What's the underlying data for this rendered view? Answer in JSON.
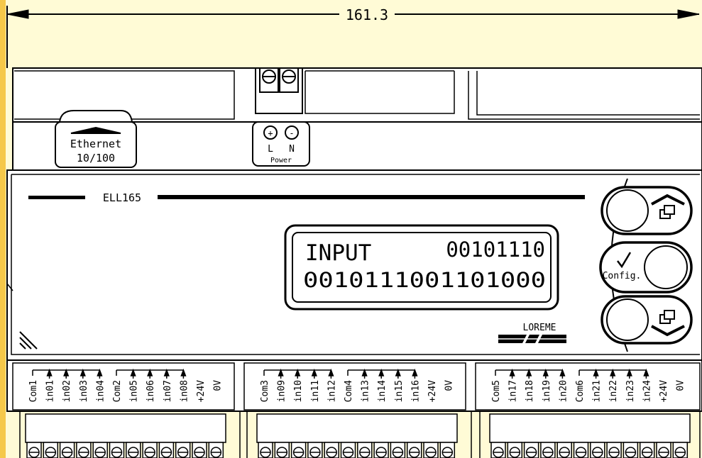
{
  "dimension": "161.3",
  "ethernet": {
    "label": "Ethernet",
    "speed": "10/100"
  },
  "power": {
    "plus": "+",
    "minus": "-",
    "l": "L",
    "n": "N",
    "label": "Power"
  },
  "model": "ELL165",
  "display": {
    "line1_left": "INPUT",
    "line1_right": "00101110",
    "line2": "0010111001101000"
  },
  "brand": "LOREME",
  "keys": {
    "config": "Config."
  },
  "terminal_groups": [
    [
      "Com1",
      "in01",
      "in02",
      "in03",
      "in04",
      "Com2",
      "in05",
      "in06",
      "in07",
      "in08",
      "+24V",
      "0V"
    ],
    [
      "Com3",
      "in09",
      "in10",
      "in11",
      "in12",
      "Com4",
      "in13",
      "in14",
      "in15",
      "in16",
      "+24V",
      "0V"
    ],
    [
      "Com5",
      "in17",
      "in18",
      "in19",
      "in20",
      "Com6",
      "in21",
      "in22",
      "in23",
      "in24",
      "+24V",
      "0V"
    ]
  ],
  "colors": {
    "background": "#fffbd6",
    "accent": "#f5c84a",
    "line": "#000000",
    "fill": "#ffffff"
  }
}
